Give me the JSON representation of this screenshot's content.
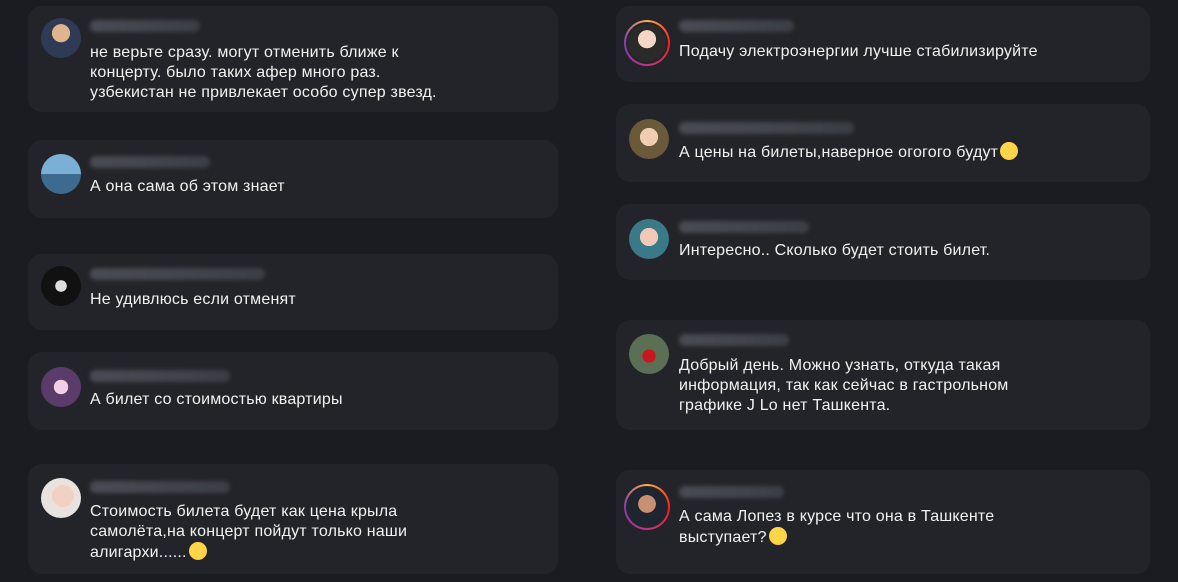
{
  "comments_left": [
    {
      "text": "не верьте сразу. могут отменить ближе к\nконцерту. было таких афер много раз.\nузбекистан не привлекает особо супер звезд.",
      "avatar": "avatar-man-suit"
    },
    {
      "text": "А она сама об этом знает",
      "avatar": "avatar-sea"
    },
    {
      "text": "Не удивлюсь если отменят",
      "avatar": "avatar-dark-logo"
    },
    {
      "text": "А билет со стоимостью квартиры",
      "avatar": "avatar-pink"
    },
    {
      "text": "Стоимость билета будет как цена крыла\nсамолёта,на концерт пойдут только наши\nалигархи......",
      "avatar": "avatar-woman",
      "emoji": "laugh-emoji"
    }
  ],
  "comments_right": [
    {
      "text": "Подачу электроэнергии лучше стабилизируйте",
      "avatar": "avatar-story-ring",
      "ring": true
    },
    {
      "text": "А цены на билеты,наверное огогого будут",
      "avatar": "avatar-girl",
      "emoji": "wow-emoji"
    },
    {
      "text": "Интересно.. Сколько будет стоить билет.",
      "avatar": "avatar-woman-2"
    },
    {
      "text": "Добрый день. Можно узнать, откуда такая\nинформация, так как сейчас в гастрольном\nграфике J Lo нет Ташкента.",
      "avatar": "avatar-red-figure"
    },
    {
      "text": "А сама Лопез в курсе что она в Ташкенте\nвыступает?",
      "avatar": "avatar-story-ring-2",
      "ring": true,
      "emoji": "laugh-emoji"
    }
  ],
  "colors": {
    "background": "#1b1c21",
    "card": "#232429",
    "text": "#f2f2f2"
  }
}
